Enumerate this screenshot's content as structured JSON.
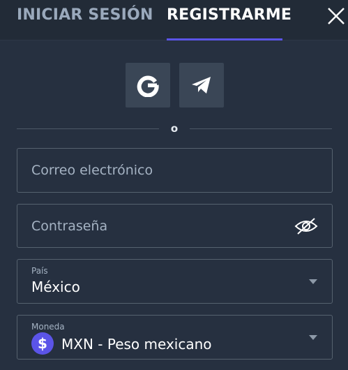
{
  "tabs": {
    "login_label": "INICIAR SESIÓN",
    "register_label": "REGISTRARME",
    "active": "register"
  },
  "social": {
    "google_icon": "google-icon",
    "telegram_icon": "telegram-icon"
  },
  "divider": {
    "text": "o"
  },
  "form": {
    "email": {
      "placeholder": "Correo electrónico",
      "value": ""
    },
    "password": {
      "placeholder": "Contraseña",
      "value": ""
    },
    "country": {
      "label": "País",
      "value": "México"
    },
    "currency": {
      "label": "Moneda",
      "symbol": "$",
      "value": "MXN - Peso mexicano"
    }
  },
  "colors": {
    "background": "#263040",
    "header": "#222b37",
    "accent": "#5b54e8",
    "button_bg": "#3a4656",
    "border": "#56626f",
    "muted_text": "#a5b3c3"
  }
}
